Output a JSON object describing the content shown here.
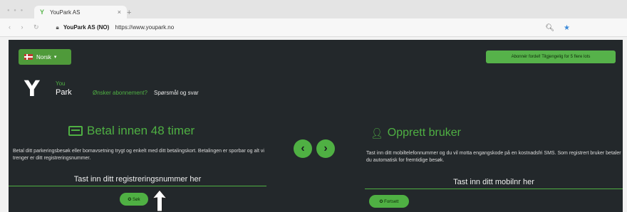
{
  "browser": {
    "tab_title": "YouPark AS",
    "tab_close": "×",
    "new_tab": "+",
    "site_name": "YouPark AS (NO)",
    "url": "https://www.youpark.no",
    "nav_glyphs": "‹ › ↻"
  },
  "header": {
    "language_label": "Norsk",
    "promo_text": "Abonnér fordel! Tilgjengelig for 5 flere lots",
    "logo_you": "You",
    "logo_park": "Park",
    "nav_subscription": "Ønsker abonnement?",
    "nav_faq": "Spørsmål og svar"
  },
  "left": {
    "title": "Betal innen 48 timer",
    "description": "Betal ditt parkeringsbesøk eller bomavsetning trygt og enkelt med ditt betalingskort. Betalingen er sporbar og alt vi trenger er ditt registreringsnummer.",
    "input_placeholder": "Tast inn ditt registreringsnummer her",
    "button_label": "✪ Søk"
  },
  "right": {
    "title": "Opprett bruker",
    "description": "Tast inn ditt mobiltelefonnummer og du vil motta engangskode på en kostnadsfri SMS. Som registrert bruker betaler du automatisk for fremtidige besøk.",
    "input_placeholder": "Tast inn ditt mobilnr her",
    "button_label": "✪ Fortsett"
  },
  "carousel": {
    "prev_glyph": "‹",
    "next_glyph": "›"
  },
  "colors": {
    "accent": "#4fb043",
    "page_bg": "#23282b",
    "text": "#dcdcdc"
  },
  "icons": [
    "payment-card-icon",
    "add-user-icon",
    "search-icon",
    "arrow-icon"
  ]
}
